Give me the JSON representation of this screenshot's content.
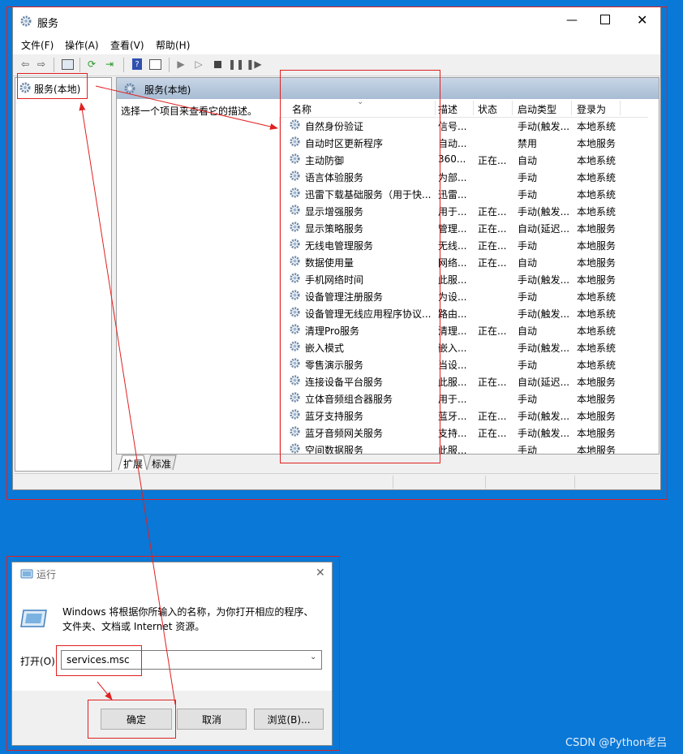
{
  "services_window": {
    "title": "服务",
    "menu": [
      "文件(F)",
      "操作(A)",
      "查看(V)",
      "帮助(H)"
    ],
    "toolbar_icons": [
      "back-icon",
      "forward-icon",
      "console-tree-icon",
      "refresh-icon",
      "export-icon",
      "help-icon",
      "properties-icon",
      "start-icon",
      "start-alt-icon",
      "stop-icon",
      "pause-icon",
      "resume-icon"
    ],
    "tree_item": "服务(本地)",
    "header_title": "服务(本地)",
    "description_hint": "选择一个项目来查看它的描述。",
    "columns": [
      "名称",
      "描述",
      "状态",
      "启动类型",
      "登录为"
    ],
    "rows": [
      [
        "自然身份验证",
        "信号...",
        "",
        "手动(触发...",
        "本地系统"
      ],
      [
        "自动时区更新程序",
        "自动...",
        "",
        "禁用",
        "本地服务"
      ],
      [
        "主动防御",
        "360...",
        "正在...",
        "自动",
        "本地系统"
      ],
      [
        "语言体验服务",
        "为部...",
        "",
        "手动",
        "本地系统"
      ],
      [
        "迅雷下载基础服务（用于快...",
        "迅雷...",
        "",
        "手动",
        "本地系统"
      ],
      [
        "显示增强服务",
        "用于...",
        "正在...",
        "手动(触发...",
        "本地系统"
      ],
      [
        "显示策略服务",
        "管理...",
        "正在...",
        "自动(延迟...",
        "本地服务"
      ],
      [
        "无线电管理服务",
        "无线...",
        "正在...",
        "手动",
        "本地服务"
      ],
      [
        "数据使用量",
        "网络...",
        "正在...",
        "自动",
        "本地服务"
      ],
      [
        "手机网络时间",
        "此服...",
        "",
        "手动(触发...",
        "本地服务"
      ],
      [
        "设备管理注册服务",
        "为设...",
        "",
        "手动",
        "本地系统"
      ],
      [
        "设备管理无线应用程序协议...",
        "路由...",
        "",
        "手动(触发...",
        "本地系统"
      ],
      [
        "清理Pro服务",
        "清理...",
        "正在...",
        "自动",
        "本地系统"
      ],
      [
        "嵌入模式",
        "嵌入...",
        "",
        "手动(触发...",
        "本地系统"
      ],
      [
        "零售演示服务",
        "当设...",
        "",
        "手动",
        "本地系统"
      ],
      [
        "连接设备平台服务",
        "此服...",
        "正在...",
        "自动(延迟...",
        "本地服务"
      ],
      [
        "立体音频组合器服务",
        "用于...",
        "",
        "手动",
        "本地服务"
      ],
      [
        "蓝牙支持服务",
        "蓝牙...",
        "正在...",
        "手动(触发...",
        "本地服务"
      ],
      [
        "蓝牙音频网关服务",
        "支持...",
        "正在...",
        "手动(触发...",
        "本地服务"
      ],
      [
        "空间数据服务",
        "此服...",
        "",
        "手动",
        "本地服务"
      ]
    ],
    "tabs": [
      "扩展",
      "标准"
    ]
  },
  "run_dialog": {
    "title": "运行",
    "description": "Windows 将根据你所输入的名称，为你打开相应的程序、文件夹、文档或 Internet 资源。",
    "open_label": "打开(O)",
    "input_value": "services.msc",
    "ok_label": "确定",
    "cancel_label": "取消",
    "browse_label": "浏览(B)..."
  },
  "watermark": "CSDN @Python老吕",
  "colors": {
    "desktop": "#0a78d7",
    "annotation": "#e02020",
    "header": "#a7bcd3"
  }
}
